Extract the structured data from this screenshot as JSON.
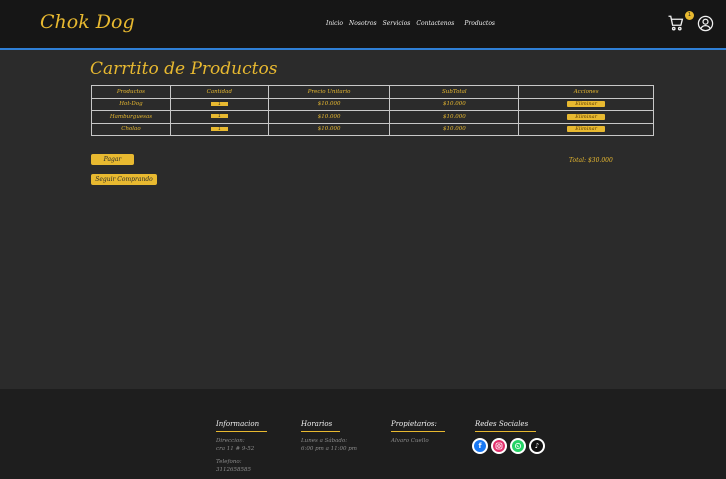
{
  "header": {
    "brand": "Chok Dog",
    "nav": [
      "Inicio",
      "Nosotros",
      "Servicios",
      "Contactenos",
      "Productos"
    ],
    "cart_count": "1",
    "cart_icon": "shopping-cart-icon",
    "user_icon": "user-circle-icon"
  },
  "page": {
    "title": "Carrtito de Productos"
  },
  "table": {
    "headers": [
      "Productos",
      "Cantidad",
      "Precio Unitario",
      "SubTotal",
      "Acciones"
    ],
    "rows": [
      {
        "product": "Hot-Dog",
        "qty": "1",
        "price": "$10.000",
        "subtotal": "$10.000",
        "action": "Eliminar"
      },
      {
        "product": "Hamburguesas",
        "qty": "1",
        "price": "$10.000",
        "subtotal": "$10.000",
        "action": "Eliminar"
      },
      {
        "product": "Cholao",
        "qty": "1",
        "price": "$10.000",
        "subtotal": "$10.000",
        "action": "Eliminar"
      }
    ]
  },
  "actions": {
    "pay": "Pagar",
    "keep_shopping": "Seguir Comprando",
    "total": "Total: $30.000"
  },
  "footer": {
    "info": {
      "title": "Informacion",
      "address_label": "Direccion:",
      "address": "cra 11 # 9-52",
      "phone_label": "Telefono:",
      "phone": "3112658585"
    },
    "hours": {
      "title": "Horarios",
      "days": "Lunes a Sábado:",
      "time": "6:00 pm a 11:00 pm"
    },
    "owners": {
      "title": "Propietarios:",
      "name": "Alvaro Cuello"
    },
    "social": {
      "title": "Redes Sociales",
      "icons": [
        "facebook-icon",
        "instagram-icon",
        "whatsapp-icon",
        "tiktok-icon"
      ]
    }
  },
  "colors": {
    "accent": "#e8b930",
    "header_bg": "#161616",
    "body_bg": "#2b2b2b",
    "footer_bg": "#1e1e1e",
    "header_border": "#2f7fd6"
  }
}
